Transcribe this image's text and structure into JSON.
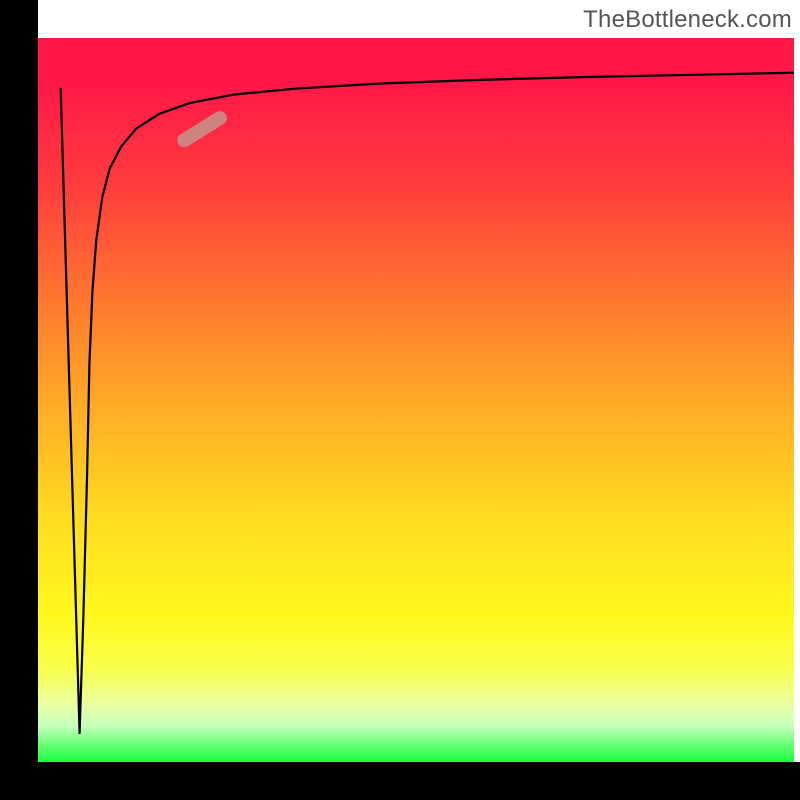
{
  "watermark": "TheBottleneck.com",
  "chart_data": {
    "type": "line",
    "title": "",
    "xlabel": "",
    "ylabel": "",
    "xlim": [
      0,
      100
    ],
    "ylim": [
      0,
      100
    ],
    "grid": false,
    "legend": false,
    "series": [
      {
        "name": "bottleneck-curve",
        "x": [
          3.0,
          5.5,
          6.0,
          6.5,
          6.8,
          7.2,
          7.7,
          8.5,
          9.5,
          11.0,
          13.0,
          16.0,
          20.0,
          26.0,
          34.0,
          45.0,
          58.0,
          72.0,
          86.0,
          100.0
        ],
        "y": [
          93.0,
          4.0,
          20.0,
          40.0,
          55.0,
          65.0,
          72.0,
          78.0,
          82.0,
          85.0,
          87.5,
          89.5,
          91.0,
          92.2,
          93.0,
          93.7,
          94.2,
          94.6,
          94.9,
          95.2
        ]
      }
    ],
    "marker": {
      "name": "highlight-pill",
      "color": "#c98b86",
      "cx_pct": 21.7,
      "cy_pct": 87.4,
      "angle_deg": 32,
      "length_pct": 7.4,
      "thickness_px": 14
    },
    "background": {
      "name": "heatmap-gradient-red-to-green",
      "stops": [
        {
          "pct": 0,
          "color": "#ff1748"
        },
        {
          "pct": 20,
          "color": "#ff3b3e"
        },
        {
          "pct": 37,
          "color": "#ff7a2e"
        },
        {
          "pct": 52,
          "color": "#ffb026"
        },
        {
          "pct": 68,
          "color": "#ffe020"
        },
        {
          "pct": 80,
          "color": "#fff81e"
        },
        {
          "pct": 92,
          "color": "#eaffa0"
        },
        {
          "pct": 97.5,
          "color": "#6cff76"
        },
        {
          "pct": 100,
          "color": "#17ff3f"
        }
      ]
    }
  }
}
